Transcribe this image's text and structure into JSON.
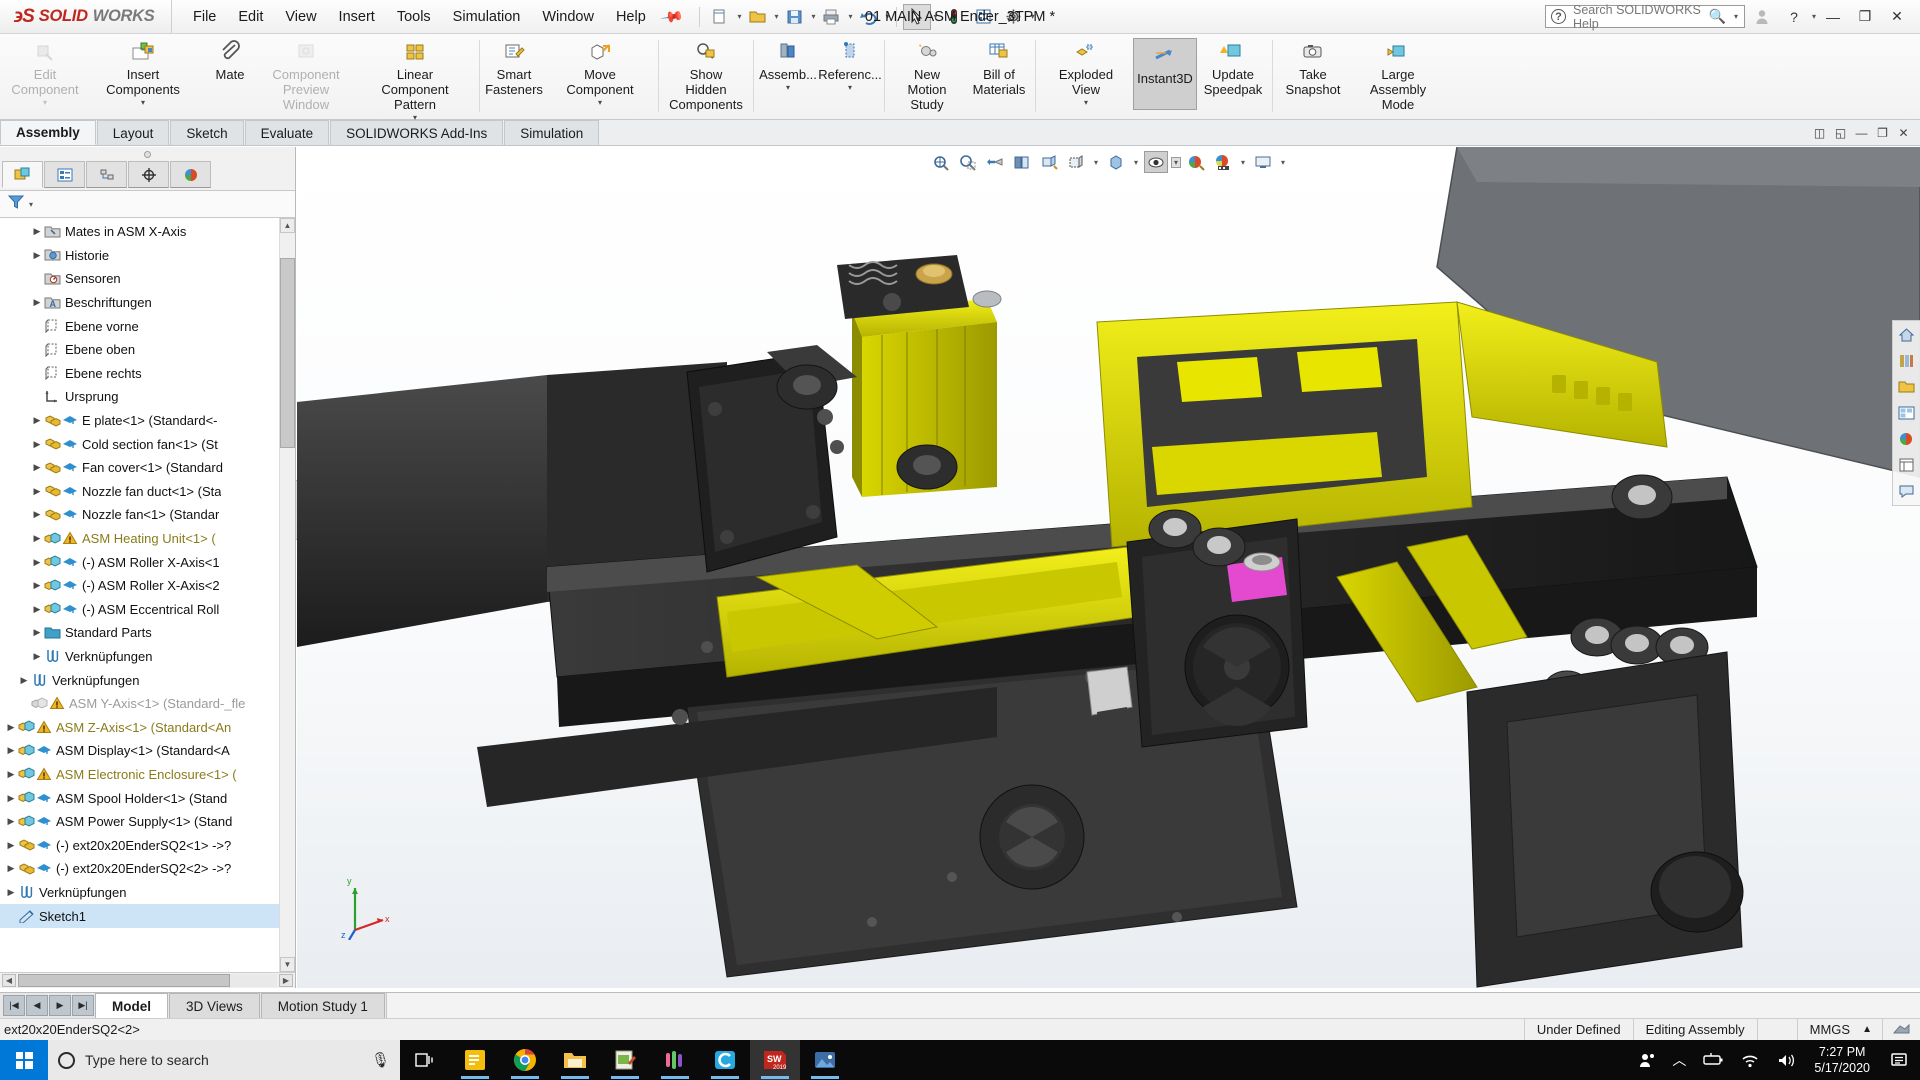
{
  "titlebar": {
    "brand_mark": "℈S",
    "brand_solid": "SOLID",
    "brand_works": "WORKS",
    "menu": [
      "File",
      "Edit",
      "View",
      "Insert",
      "Tools",
      "Simulation",
      "Window",
      "Help"
    ],
    "pin_icon": "pushpin-icon",
    "document_title": "01 MAIN ASM Ender_3TPM *",
    "help_search_placeholder": "Search SOLIDWORKS Help",
    "quick_access": [
      {
        "name": "new-document-icon",
        "glyph": "🗋"
      },
      {
        "name": "open-document-icon",
        "glyph": "📂"
      },
      {
        "name": "save-icon",
        "glyph": "💾"
      },
      {
        "name": "print-icon",
        "glyph": "🖶"
      },
      {
        "name": "undo-icon",
        "glyph": "↩"
      },
      {
        "name": "select-arrow-icon",
        "glyph": "↖"
      },
      {
        "name": "rebuild-icon",
        "glyph": "🚦"
      },
      {
        "name": "options-list-icon",
        "glyph": "▤"
      },
      {
        "name": "settings-gear-icon",
        "glyph": "⚙"
      }
    ],
    "window_buttons": {
      "user": "user-account-icon",
      "help": "?",
      "minimize": "—",
      "restore": "❐",
      "close": "✕"
    }
  },
  "ribbon": {
    "buttons": [
      {
        "label": "Edit Component",
        "name": "edit-component-button",
        "disabled": true,
        "caret": true,
        "icon": "edit-component-icon"
      },
      {
        "label": "Insert Components",
        "name": "insert-components-button",
        "disabled": false,
        "caret": true,
        "icon": "insert-components-icon"
      },
      {
        "label": "Mate",
        "name": "mate-button",
        "disabled": false,
        "caret": false,
        "icon": "mate-paperclip-icon"
      },
      {
        "label": "Component Preview Window",
        "name": "component-preview-window-button",
        "disabled": true,
        "caret": false,
        "icon": "component-preview-icon"
      },
      {
        "label": "Linear Component Pattern",
        "name": "linear-component-pattern-button",
        "disabled": false,
        "caret": true,
        "icon": "linear-pattern-icon"
      },
      {
        "label": "Smart Fasteners",
        "name": "smart-fasteners-button",
        "disabled": false,
        "caret": false,
        "icon": "smart-fasteners-icon"
      },
      {
        "label": "Move Component",
        "name": "move-component-button",
        "disabled": false,
        "caret": true,
        "icon": "move-component-icon"
      },
      {
        "label": "Show Hidden Components",
        "name": "show-hidden-components-button",
        "disabled": false,
        "caret": false,
        "icon": "show-hidden-components-icon"
      },
      {
        "label": "Assemb...",
        "name": "assembly-features-button",
        "disabled": false,
        "caret": true,
        "icon": "assembly-features-icon"
      },
      {
        "label": "Referenc...",
        "name": "reference-geometry-button",
        "disabled": false,
        "caret": true,
        "icon": "reference-geometry-icon"
      },
      {
        "label": "New Motion Study",
        "name": "new-motion-study-button",
        "disabled": false,
        "caret": false,
        "icon": "new-motion-study-icon"
      },
      {
        "label": "Bill of Materials",
        "name": "bill-of-materials-button",
        "disabled": false,
        "caret": false,
        "icon": "bill-of-materials-icon"
      },
      {
        "label": "Exploded View",
        "name": "exploded-view-button",
        "disabled": false,
        "caret": true,
        "icon": "exploded-view-icon"
      },
      {
        "label": "Instant3D",
        "name": "instant3d-button",
        "disabled": false,
        "caret": false,
        "active": true,
        "icon": "instant3d-icon"
      },
      {
        "label": "Update Speedpak",
        "name": "update-speedpak-button",
        "disabled": false,
        "caret": false,
        "icon": "update-speedpak-icon"
      },
      {
        "label": "Take Snapshot",
        "name": "take-snapshot-button",
        "disabled": false,
        "caret": false,
        "icon": "camera-icon"
      },
      {
        "label": "Large Assembly Mode",
        "name": "large-assembly-mode-button",
        "disabled": false,
        "caret": false,
        "icon": "large-assembly-mode-icon"
      }
    ]
  },
  "command_tabs": {
    "tabs": [
      "Assembly",
      "Layout",
      "Sketch",
      "Evaluate",
      "SOLIDWORKS Add-Ins",
      "Simulation"
    ],
    "active": "Assembly",
    "window_controls": [
      "tile-icon",
      "restore-view-icon",
      "minimize-view-icon",
      "restore-window-icon",
      "close-view-icon"
    ]
  },
  "tree_panel": {
    "tabs": [
      {
        "name": "feature-manager-tab",
        "icon": "assembly-tree-icon",
        "active": true
      },
      {
        "name": "property-manager-tab",
        "icon": "property-list-icon",
        "active": false
      },
      {
        "name": "configuration-manager-tab",
        "icon": "configuration-icon",
        "active": false
      },
      {
        "name": "dimxpert-manager-tab",
        "icon": "dimxpert-icon",
        "active": false
      },
      {
        "name": "display-manager-tab",
        "icon": "appearance-sphere-icon",
        "active": false
      }
    ],
    "filter_icon": "filter-funnel-icon",
    "items": [
      {
        "label": "Mates in ASM X-Axis",
        "icon": "mates-folder-icon",
        "twist": true,
        "indent": 2,
        "style": "normal"
      },
      {
        "label": "Historie",
        "icon": "history-folder-icon",
        "twist": true,
        "indent": 2,
        "style": "normal"
      },
      {
        "label": "Sensoren",
        "icon": "sensors-folder-icon",
        "twist": false,
        "indent": 2,
        "style": "normal"
      },
      {
        "label": "Beschriftungen",
        "icon": "annotations-folder-icon",
        "twist": true,
        "indent": 2,
        "style": "normal"
      },
      {
        "label": "Ebene vorne",
        "icon": "plane-icon",
        "twist": false,
        "indent": 2,
        "style": "normal"
      },
      {
        "label": "Ebene oben",
        "icon": "plane-icon",
        "twist": false,
        "indent": 2,
        "style": "normal"
      },
      {
        "label": "Ebene rechts",
        "icon": "plane-icon",
        "twist": false,
        "indent": 2,
        "style": "normal"
      },
      {
        "label": "Ursprung",
        "icon": "origin-icon",
        "twist": false,
        "indent": 2,
        "style": "normal"
      },
      {
        "label": "E plate<1> (Standard<-",
        "icon": "part-icon",
        "badge": "mated-icon",
        "twist": true,
        "indent": 2,
        "style": "normal"
      },
      {
        "label": "Cold section fan<1> (St",
        "icon": "part-icon",
        "badge": "mated-icon",
        "twist": true,
        "indent": 2,
        "style": "normal"
      },
      {
        "label": "Fan cover<1> (Standard",
        "icon": "part-icon",
        "badge": "mated-icon",
        "twist": true,
        "indent": 2,
        "style": "normal"
      },
      {
        "label": "Nozzle fan duct<1> (Sta",
        "icon": "part-icon",
        "badge": "mated-icon",
        "twist": true,
        "indent": 2,
        "style": "normal"
      },
      {
        "label": "Nozzle fan<1> (Standar",
        "icon": "part-icon",
        "badge": "mated-icon",
        "twist": true,
        "indent": 2,
        "style": "normal"
      },
      {
        "label": "ASM Heating Unit<1> (",
        "icon": "assembly-icon",
        "badge": "warning-icon",
        "twist": true,
        "indent": 2,
        "style": "warn"
      },
      {
        "label": "(-) ASM Roller X-Axis<1",
        "icon": "assembly-icon",
        "badge": "mated-icon",
        "twist": true,
        "indent": 2,
        "style": "normal"
      },
      {
        "label": "(-) ASM Roller X-Axis<2",
        "icon": "assembly-icon",
        "badge": "mated-icon",
        "twist": true,
        "indent": 2,
        "style": "normal"
      },
      {
        "label": "(-) ASM Eccentrical Roll",
        "icon": "assembly-icon",
        "badge": "mated-icon",
        "twist": true,
        "indent": 2,
        "style": "normal"
      },
      {
        "label": "Standard Parts",
        "icon": "folder-blue-icon",
        "twist": true,
        "indent": 2,
        "style": "normal"
      },
      {
        "label": "Verknüpfungen",
        "icon": "mates-icon",
        "twist": true,
        "indent": 2,
        "style": "normal"
      },
      {
        "label": "Verknüpfungen",
        "icon": "mates-icon",
        "twist": true,
        "indent": 1,
        "style": "normal"
      },
      {
        "label": "ASM Y-Axis<1> (Standard-_fle",
        "icon": "assembly-suppressed-icon",
        "badge": "warning-icon",
        "twist": false,
        "indent": 1,
        "style": "suppressed"
      },
      {
        "label": "ASM Z-Axis<1> (Standard<An",
        "icon": "assembly-icon",
        "badge": "warning-icon",
        "twist": true,
        "indent": 0,
        "style": "warn"
      },
      {
        "label": "ASM Display<1> (Standard<A",
        "icon": "assembly-icon",
        "badge": "mated-icon",
        "twist": true,
        "indent": 0,
        "style": "normal"
      },
      {
        "label": "ASM Electronic Enclosure<1> (",
        "icon": "assembly-icon",
        "badge": "warning-icon",
        "twist": true,
        "indent": 0,
        "style": "warn"
      },
      {
        "label": "ASM Spool Holder<1> (Stand",
        "icon": "assembly-icon",
        "badge": "mated-icon",
        "twist": true,
        "indent": 0,
        "style": "normal"
      },
      {
        "label": "ASM Power Supply<1> (Stand",
        "icon": "assembly-icon",
        "badge": "mated-icon",
        "twist": true,
        "indent": 0,
        "style": "normal"
      },
      {
        "label": "(-) ext20x20EnderSQ2<1> ->?",
        "icon": "part-icon",
        "badge": "mated-icon",
        "twist": true,
        "indent": 0,
        "style": "normal"
      },
      {
        "label": "(-) ext20x20EnderSQ2<2> ->?",
        "icon": "part-icon",
        "badge": "mated-icon",
        "twist": true,
        "indent": 0,
        "style": "normal"
      },
      {
        "label": "Verknüpfungen",
        "icon": "mates-icon",
        "twist": true,
        "indent": 0,
        "style": "normal"
      },
      {
        "label": "Sketch1",
        "icon": "sketch-icon",
        "twist": false,
        "indent": 0,
        "style": "normal",
        "selected": true
      }
    ]
  },
  "viewport": {
    "hud_buttons": [
      {
        "name": "zoom-to-fit-icon",
        "glyph": "⊕",
        "caret": false
      },
      {
        "name": "zoom-to-area-icon",
        "glyph": "🔍",
        "caret": false
      },
      {
        "name": "previous-view-icon",
        "glyph": "↩",
        "caret": false
      },
      {
        "name": "section-view-icon",
        "glyph": "▤",
        "caret": false
      },
      {
        "name": "view-orientation-icon",
        "glyph": "◫",
        "caret": false
      },
      {
        "name": "display-style-icon",
        "glyph": "▣",
        "caret": true
      },
      {
        "name": "hide-show-items-icon",
        "glyph": "◻",
        "caret": true
      },
      {
        "name": "view-settings-icon",
        "glyph": "◉",
        "caret": true,
        "active": true
      },
      {
        "name": "apply-scene-icon",
        "glyph": "🎨",
        "caret": false
      },
      {
        "name": "view-setting-sphere-icon",
        "glyph": "🌐",
        "caret": true
      },
      {
        "name": "viewport-layout-icon",
        "glyph": "🖵",
        "caret": true
      }
    ],
    "task_pane": [
      {
        "name": "solidworks-resources-icon",
        "glyph": "🏠"
      },
      {
        "name": "design-library-icon",
        "glyph": "▤"
      },
      {
        "name": "file-explorer-icon",
        "glyph": "📁"
      },
      {
        "name": "view-palette-icon",
        "glyph": "▦"
      },
      {
        "name": "appearances-scenes-icon",
        "glyph": "🎨"
      },
      {
        "name": "custom-properties-icon",
        "glyph": "▤"
      },
      {
        "name": "solidworks-forum-icon",
        "glyph": "◱"
      }
    ],
    "triad_labels": {
      "x": "x",
      "y": "y",
      "z": "z"
    }
  },
  "bottom": {
    "nav_arrows": [
      "⏮",
      "◀",
      "▶",
      "⏭"
    ],
    "tabs": [
      "Model",
      "3D Views",
      "Motion Study 1"
    ],
    "active_tab": "Model",
    "status_left": "ext20x20EnderSQ2<2>",
    "status_right": [
      "Under Defined",
      "Editing Assembly",
      "",
      "MMGS",
      "▲"
    ],
    "status_icon": "sheet-properties-icon"
  },
  "taskbar": {
    "search_placeholder": "Type here to search",
    "items": [
      {
        "name": "task-view-icon",
        "glyph": "❑",
        "running": false
      },
      {
        "name": "sticky-notes-icon",
        "glyph": "🗒",
        "running": true
      },
      {
        "name": "google-chrome-icon",
        "glyph": "◉",
        "running": true
      },
      {
        "name": "file-explorer-icon",
        "glyph": "📁",
        "running": true
      },
      {
        "name": "notepad-editor-icon",
        "glyph": "📝",
        "running": true
      },
      {
        "name": "prusa-slicer-icon",
        "glyph": "▮",
        "running": true
      },
      {
        "name": "cura-icon",
        "glyph": "C",
        "running": true
      },
      {
        "name": "solidworks-2019-icon",
        "glyph": "SW",
        "running": true,
        "focused": true,
        "badge": "2019"
      },
      {
        "name": "photos-app-icon",
        "glyph": "🖼",
        "running": true
      }
    ],
    "tray": [
      {
        "name": "people-icon",
        "glyph": "👤"
      },
      {
        "name": "show-hidden-icons-chevron",
        "glyph": "︿"
      },
      {
        "name": "battery-icon",
        "glyph": "🔋"
      },
      {
        "name": "wifi-icon",
        "glyph": "📶"
      },
      {
        "name": "volume-icon",
        "glyph": "🔊"
      }
    ],
    "clock_time": "7:27 PM",
    "clock_date": "5/17/2020",
    "action_center_icon": "notification-icon"
  },
  "colors": {
    "brand_red": "#c0261e",
    "accent_blue": "#0078d7",
    "model_yellow": "#d6d200",
    "model_dark": "#2b2b2b"
  }
}
